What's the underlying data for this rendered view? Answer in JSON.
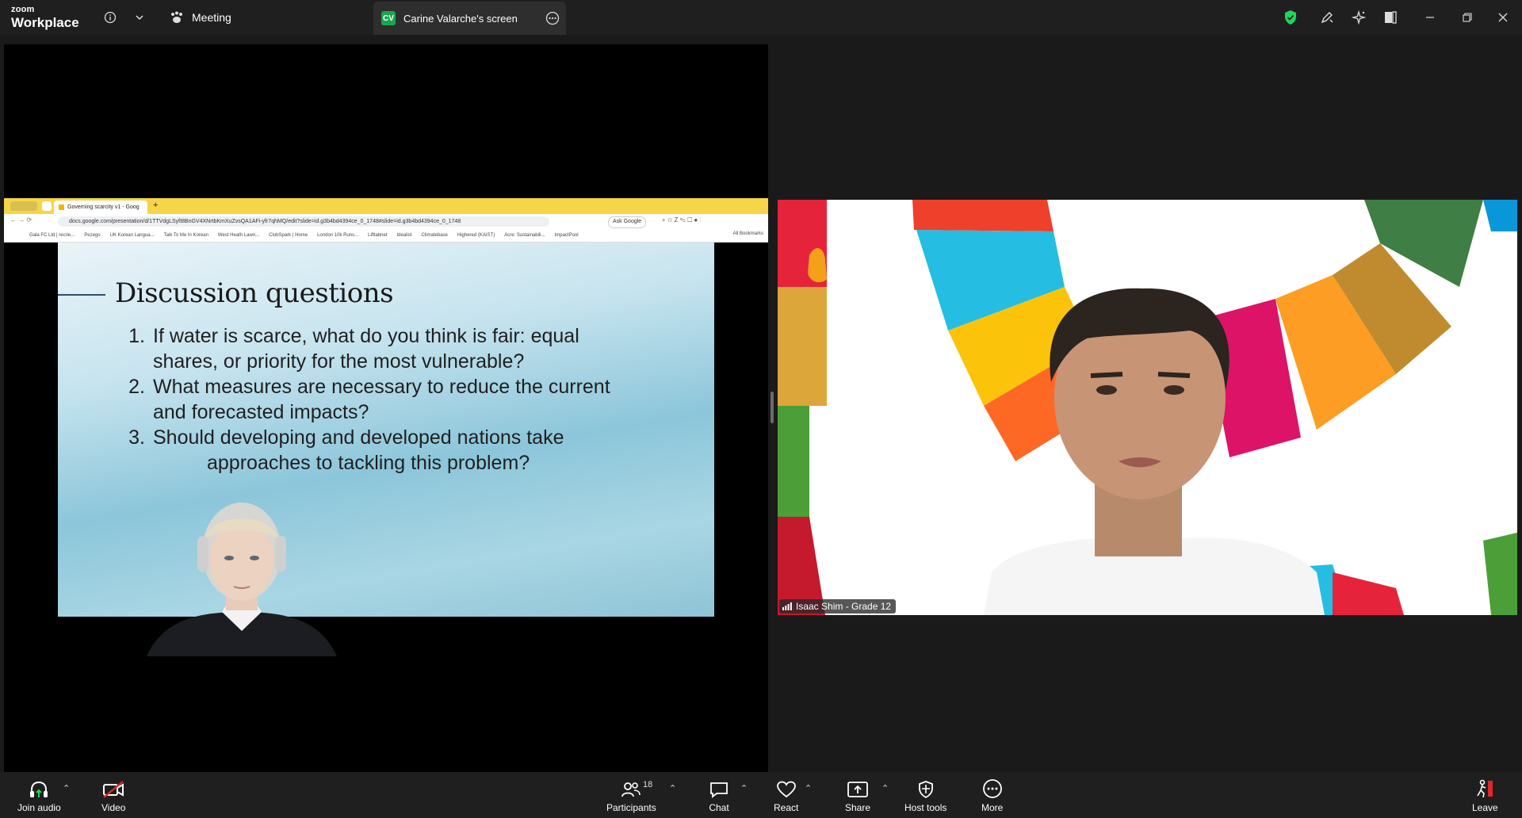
{
  "app": {
    "brand_small": "zoom",
    "brand_large": "Workplace"
  },
  "topbar": {
    "meeting_label": "Meeting",
    "screen_tab": {
      "initials": "CV",
      "label": "Carine Valarche's screen"
    }
  },
  "shared_screen": {
    "browser": {
      "tab_title": "Governing scarcity v1 - Goog",
      "url": "docs.google.com/presentation/d/1TTVdgLSyfI8BnGV4XNrtbKmXuZvsQA1AFi-yfr7qhMQ/edit?slide=id.g3b4bd4394ce_0_1748#slide=id.g3b4bd4394ce_0_1748",
      "ask_label": "Ask Google",
      "bookmarks": [
        "Gala FC Ltd | recrie...",
        "Pezego",
        "UK Korean Langua...",
        "Talk To Me In Korean",
        "West Heath Lawn...",
        "ClubSpark | Home",
        "London 10k Runs...",
        "Liftlabnet",
        "Idealist",
        "Climatebase",
        "Highered (KAIST)",
        "Acre: Sustainabili...",
        "ImpactPool"
      ],
      "all_bookmarks": "All Bookmarks"
    },
    "slide": {
      "title": "Discussion questions",
      "questions": [
        {
          "num": "1.",
          "line1": "If water is scarce, what do you think is fair: equal",
          "line2": "shares, or priority for the most vulnerable?"
        },
        {
          "num": "2.",
          "line1": "What measures are necessary to reduce the current",
          "line2": "and forecasted impacts?"
        },
        {
          "num": "3.",
          "line1": "Should developing and developed nations take",
          "line2": "approaches to tackling this problem?"
        }
      ]
    }
  },
  "video": {
    "participant_name": "Isaac Shim - Grade 12"
  },
  "toolbar": {
    "join_audio": "Join audio",
    "video": "Video",
    "participants": "Participants",
    "participants_count": "18",
    "chat": "Chat",
    "react": "React",
    "share": "Share",
    "host_tools": "Host tools",
    "more": "More",
    "leave": "Leave"
  },
  "colors": {
    "secure_green": "#1ed65b",
    "leave_red": "#e02828",
    "video_off_red": "#e02828",
    "cv_badge": "#1aa64c",
    "browser_tab_yellow": "#f6d548"
  }
}
